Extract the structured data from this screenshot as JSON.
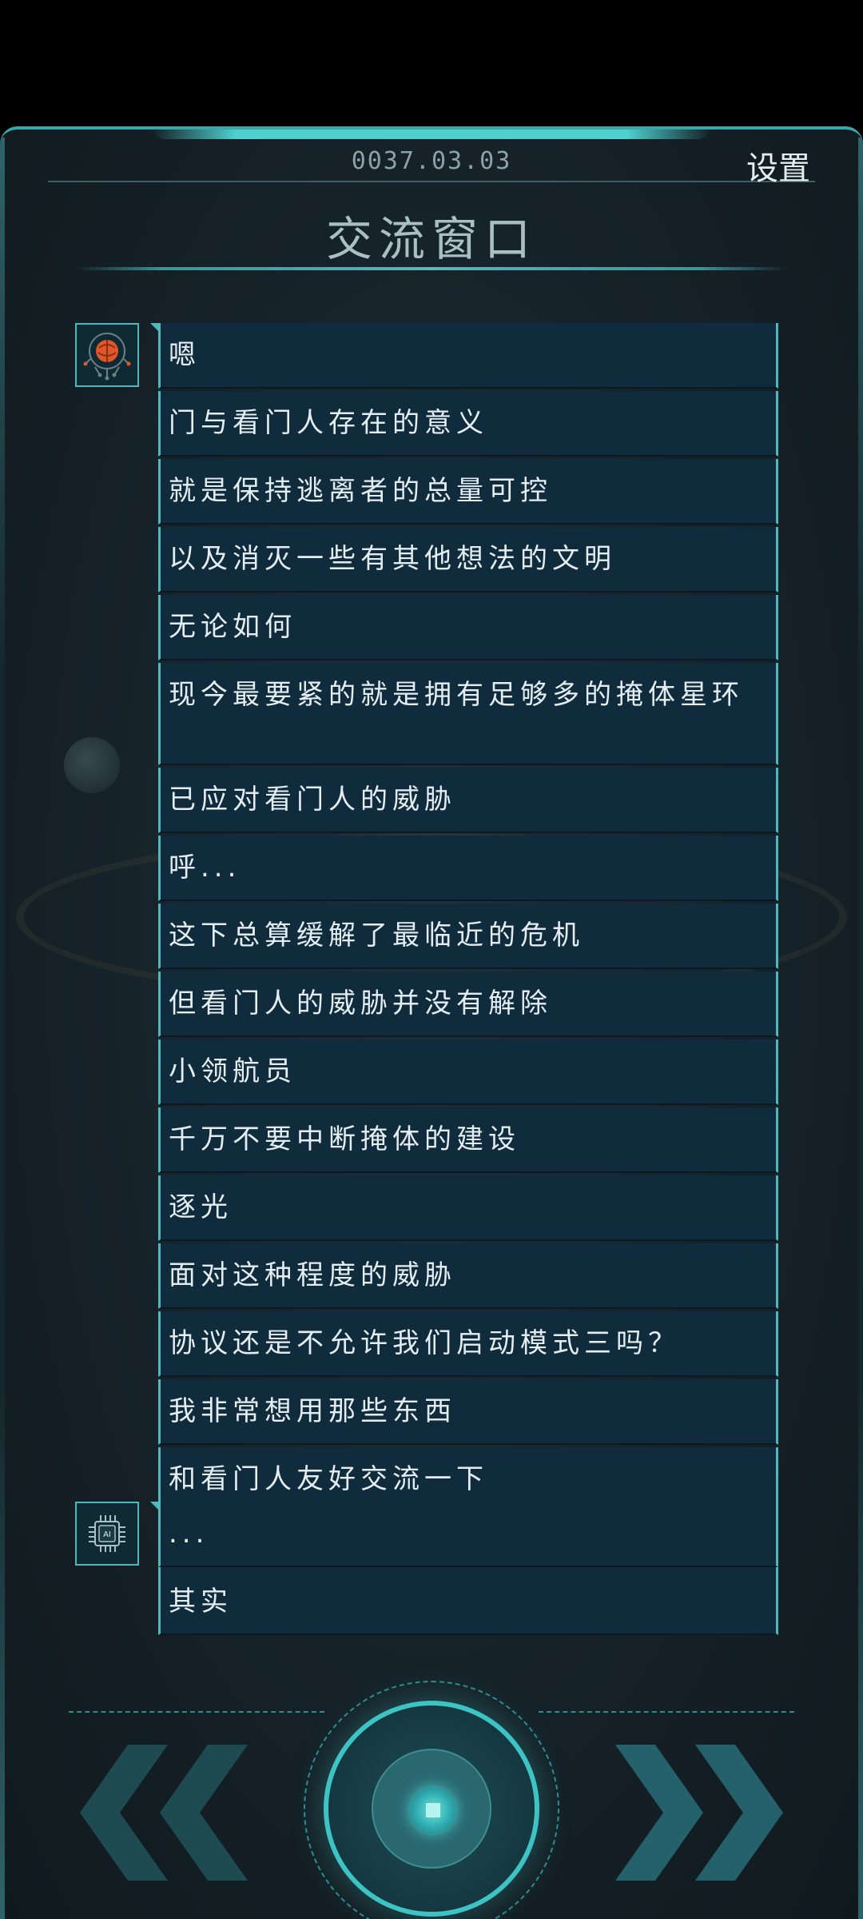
{
  "header": {
    "date": "0037.03.03",
    "settings_label": "设置",
    "title": "交流窗口"
  },
  "messages": {
    "group1": {
      "avatar_icon": "orange-orb-avatar-icon",
      "lines": [
        "嗯",
        "门与看门人存在的意义",
        "就是保持逃离者的总量可控",
        "以及消灭一些有其他想法的文明",
        "无论如何",
        "现今最要紧的就是拥有足够多的掩体星环",
        "已应对看门人的威胁",
        "呼...",
        "这下总算缓解了最临近的危机",
        "但看门人的威胁并没有解除",
        "小领航员",
        "千万不要中断掩体的建设",
        "逐光",
        "面对这种程度的威胁",
        "协议还是不允许我们启动模式三吗？",
        "我非常想用那些东西",
        "和看门人友好交流一下",
        "(*^▽^*)"
      ]
    },
    "group2": {
      "avatar_icon": "ai-chip-icon",
      "avatar_label": "AI",
      "lines": [
        "...",
        "其实"
      ]
    }
  },
  "controls": {
    "prev_icon": "double-chevron-left-icon",
    "next_icon": "double-chevron-right-icon",
    "stop_icon": "stop-icon"
  },
  "colors": {
    "accent": "#4fb8bd",
    "bubble_bg": "#102c3c",
    "panel_bg": "#17242b",
    "avatar_orange": "#e0582a"
  }
}
